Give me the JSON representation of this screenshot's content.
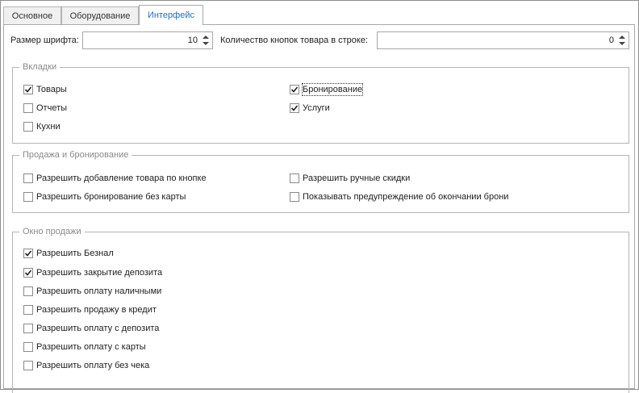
{
  "tabs": [
    {
      "label": "Основное",
      "active": false
    },
    {
      "label": "Оборудование",
      "active": false
    },
    {
      "label": "Интерфейс",
      "active": true
    }
  ],
  "font_size": {
    "label": "Размер шрифта:",
    "value": "10"
  },
  "buttons_per_row": {
    "label": "Количество кнопок товара в строке:",
    "value": "0"
  },
  "tabs_group": {
    "title": "Вкладки",
    "items": [
      {
        "label": "Товары",
        "checked": true
      },
      {
        "label": "Отчеты",
        "checked": false
      },
      {
        "label": "Кухни",
        "checked": false
      },
      {
        "label": "Бронирование",
        "checked": true,
        "focused": true
      },
      {
        "label": "Услуги",
        "checked": true
      }
    ]
  },
  "sales_group": {
    "title": "Продажа и бронирование",
    "items": [
      {
        "label": "Разрешить добавление товара по кнопке",
        "checked": false
      },
      {
        "label": "Разрешить бронирование без карты",
        "checked": false
      },
      {
        "label": "Разрешить ручные скидки",
        "checked": false
      },
      {
        "label": "Показывать предупреждение об окончании брони",
        "checked": false
      }
    ]
  },
  "window_group": {
    "title": "Окно продажи",
    "items": [
      {
        "label": "Разрешить Безнал",
        "checked": true
      },
      {
        "label": "Разрешить закрытие депозита",
        "checked": true
      },
      {
        "label": "Разрешить оплату наличными",
        "checked": false
      },
      {
        "label": "Разрешить продажу в кредит",
        "checked": false
      },
      {
        "label": "Разрешить оплату с депозита",
        "checked": false
      },
      {
        "label": "Разрешить оплату с карты",
        "checked": false
      },
      {
        "label": "Разрешить оплату без чека",
        "checked": false
      }
    ]
  },
  "icons": {
    "check": "checkmark",
    "spin_up": "triangle-up",
    "spin_down": "triangle-down"
  },
  "colors": {
    "accent": "#1f6fbf",
    "border": "#a8a8a8",
    "checkbox_border": "#8a8a8a",
    "background": "#ffffff"
  }
}
